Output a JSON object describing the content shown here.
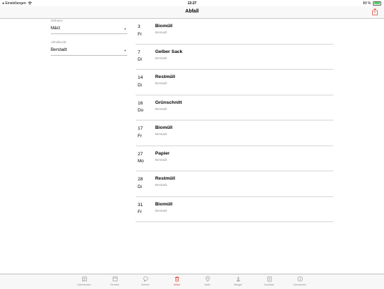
{
  "status": {
    "back_label": "Einstellungen",
    "time": "13:27",
    "battery": "99 %",
    "battery_level": 0.99
  },
  "header": {
    "title": "Abfall"
  },
  "filters": {
    "period": {
      "label": "Zeitraum",
      "value": "März"
    },
    "district": {
      "label": "Abholbezirk",
      "value": "Berstadt"
    }
  },
  "entries": [
    {
      "day": "3",
      "weekday": "Fr",
      "title": "Biomüll",
      "location": "Berstadt"
    },
    {
      "day": "7",
      "weekday": "Di",
      "title": "Gelber Sack",
      "location": "Berstadt"
    },
    {
      "day": "14",
      "weekday": "Di",
      "title": "Restmüll",
      "location": "Berstadt"
    },
    {
      "day": "16",
      "weekday": "Do",
      "title": "Grünschnitt",
      "location": "Berstadt"
    },
    {
      "day": "17",
      "weekday": "Fr",
      "title": "Biomüll",
      "location": "Berstadt"
    },
    {
      "day": "27",
      "weekday": "Mo",
      "title": "Papier",
      "location": "Berstadt"
    },
    {
      "day": "28",
      "weekday": "Di",
      "title": "Restmüll",
      "location": "Berstadt"
    },
    {
      "day": "31",
      "weekday": "Fr",
      "title": "Biomüll",
      "location": "Berstadt"
    }
  ],
  "tabs": [
    {
      "label": "Nachrichten",
      "icon": "newspaper-icon"
    },
    {
      "label": "Termine",
      "icon": "calendar-icon"
    },
    {
      "label": "Vereine",
      "icon": "speech-bubble-icon"
    },
    {
      "label": "Abfall",
      "icon": "trash-icon",
      "active": true
    },
    {
      "label": "Karte",
      "icon": "map-pin-icon"
    },
    {
      "label": "Mängel",
      "icon": "traffic-cone-icon"
    },
    {
      "label": "Kontakte",
      "icon": "contacts-icon"
    },
    {
      "label": "Gemeinden",
      "icon": "info-icon"
    }
  ],
  "colors": {
    "accent": "#e34a33",
    "battery": "#4cd964",
    "muted": "#8e8e93"
  }
}
